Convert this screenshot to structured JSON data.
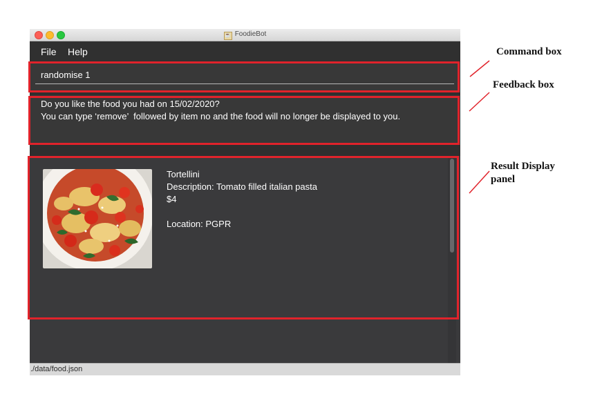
{
  "window": {
    "title": "FoodieBot"
  },
  "menu": {
    "file_label": "File",
    "help_label": "Help"
  },
  "command_box": {
    "value": "randomise 1"
  },
  "feedback_box": {
    "line1": "Do you like the food you had on 15/02/2020?",
    "line2": "You can type ‘remove’  followed by item no and the food will no longer be displayed to you."
  },
  "result_display": {
    "cards": [
      {
        "name": "Tortellini",
        "description": "Description: Tomato filled italian pasta",
        "price": "$4",
        "location": "Location: PGPR",
        "image_icon": "food-photo"
      }
    ]
  },
  "status_bar": {
    "path": "./data/food.json"
  },
  "annotations": {
    "command_label": "Command box",
    "feedback_label": "Feedback box",
    "result_label_line1": "Result Display",
    "result_label_line2": "panel",
    "highlight_color": "#e1232b"
  }
}
